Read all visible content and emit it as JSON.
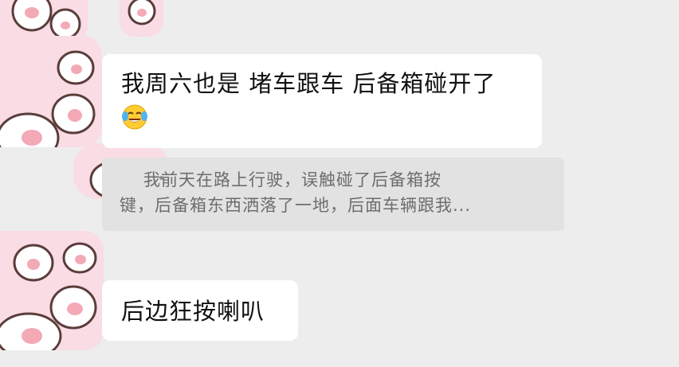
{
  "messages": [
    {
      "text": "我周六也是 堵车跟车 后备箱碰开了",
      "emoji": "face-with-tears-of-joy"
    },
    {
      "text": "后边狂按喇叭"
    }
  ],
  "quote": {
    "line1": "我前天在路上行驶，误触碰了后备箱按",
    "line2": "键，后备箱东西洒落了一地，后面车辆跟我..."
  },
  "colors": {
    "background": "#ededed",
    "bubble": "#ffffff",
    "quote_bg": "#e2e2e2",
    "quote_text": "#6d6d6d",
    "avatar_pink": "#f9dce4",
    "paw_outline": "#5a3d3a",
    "paw_pad": "#f3a9b6"
  }
}
